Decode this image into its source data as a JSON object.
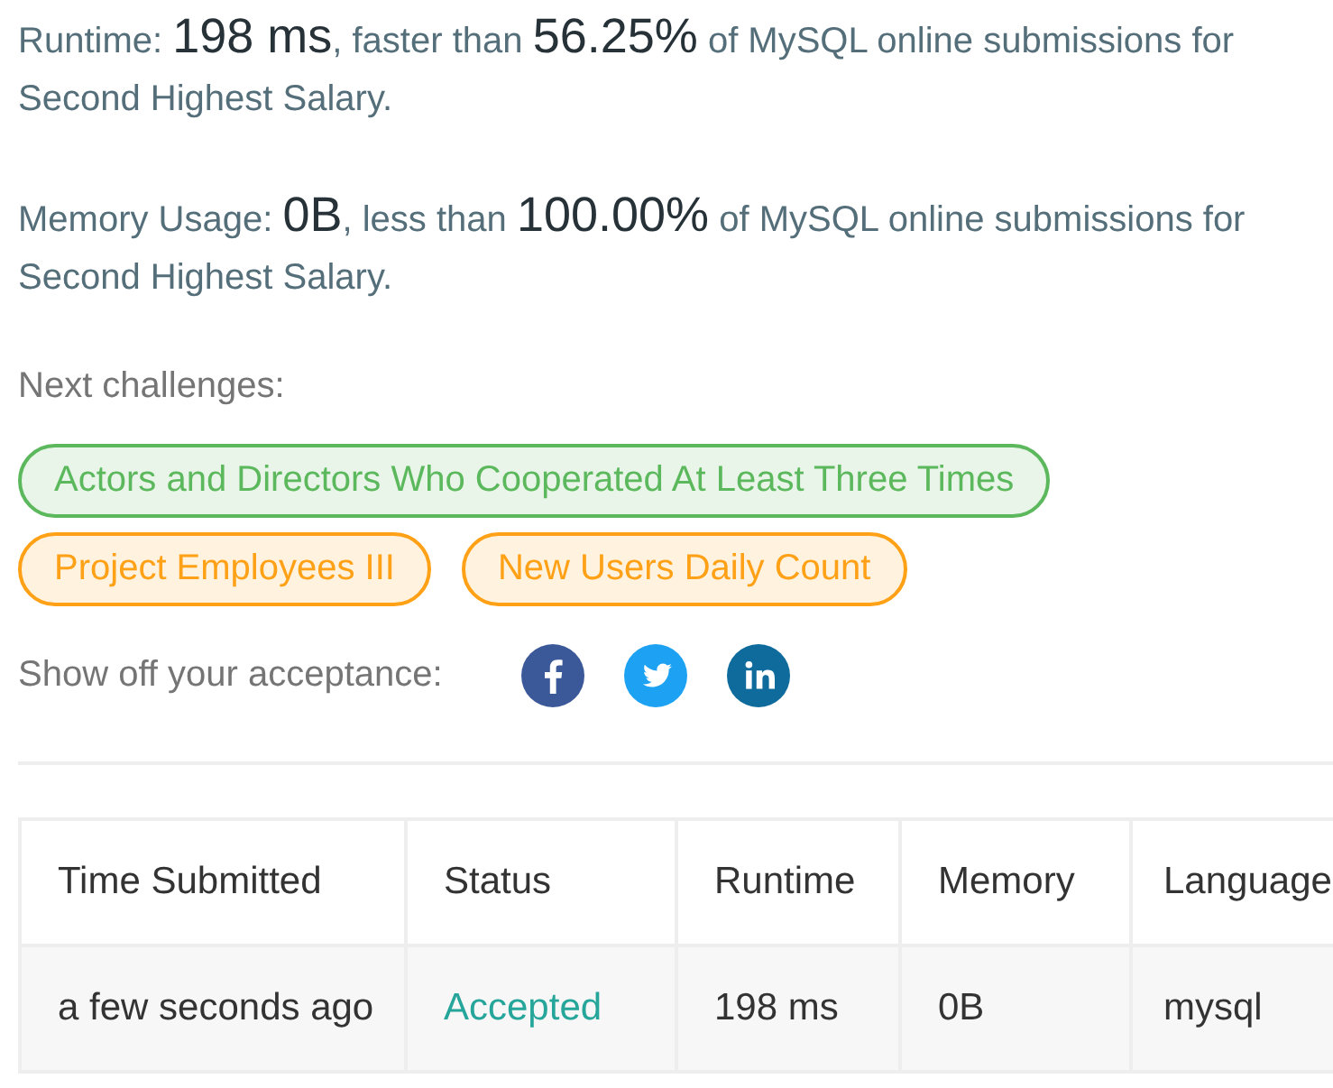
{
  "stats": [
    {
      "label": "Runtime:",
      "value": "198 ms",
      "middle": ", faster than",
      "percent": "56.25%",
      "tail": "of MySQL online submissions for Second Highest Salary."
    },
    {
      "label": "Memory Usage:",
      "value": "0B",
      "middle": ", less than",
      "percent": "100.00%",
      "tail": "of MySQL online submissions for Second Highest Salary."
    }
  ],
  "next_challenges": {
    "heading": "Next challenges:",
    "items": [
      {
        "title": "Actors and Directors Who Cooperated At Least Three Times",
        "color": "#5cb85c"
      },
      {
        "title": "Project Employees III",
        "color": "#ffa116"
      },
      {
        "title": "New Users Daily Count",
        "color": "#ffa116"
      }
    ]
  },
  "share": {
    "label": "Show off your acceptance:"
  },
  "table": {
    "columns": [
      "Time Submitted",
      "Status",
      "Runtime",
      "Memory",
      "Language"
    ],
    "rows": [
      {
        "time": "a few seconds ago",
        "status": "Accepted",
        "accepted": true,
        "runtime": "198 ms",
        "memory": "0B",
        "language": "mysql"
      }
    ]
  }
}
